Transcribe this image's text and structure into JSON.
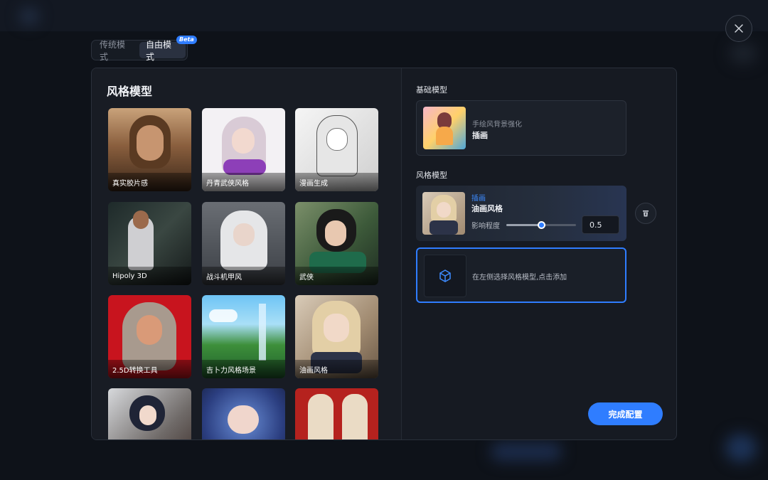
{
  "mode_switch": {
    "tabs": [
      "传统模式",
      "自由模式"
    ],
    "active": "自由模式",
    "badge": "Beta"
  },
  "left": {
    "title": "风格模型",
    "cards": [
      {
        "label": "真实胶片感"
      },
      {
        "label": "丹青武侠风格"
      },
      {
        "label": "漫画生成"
      },
      {
        "label": "Hipoly 3D"
      },
      {
        "label": "战斗机甲风"
      },
      {
        "label": "武侠"
      },
      {
        "label": "2.5D转换工具"
      },
      {
        "label": "吉卜力风格场景"
      },
      {
        "label": "油画风格"
      },
      {
        "label": ""
      },
      {
        "label": ""
      },
      {
        "label": ""
      }
    ]
  },
  "right": {
    "base_section": "基础模型",
    "base_model": {
      "subtitle": "手绘风背景强化",
      "title": "插画"
    },
    "style_section": "风格模型",
    "style_model": {
      "tag": "插画",
      "name": "油画风格",
      "influence_label": "影响程度",
      "influence_value": "0.5",
      "slider_fraction": 0.5
    },
    "add_hint": "在左侧选择风格模型,点击添加",
    "done_label": "完成配置"
  },
  "icons": {
    "close": "close-icon",
    "delete": "trash-icon",
    "add": "cube-icon"
  },
  "colors": {
    "accent": "#2f7dff",
    "panel": "#161a22"
  }
}
